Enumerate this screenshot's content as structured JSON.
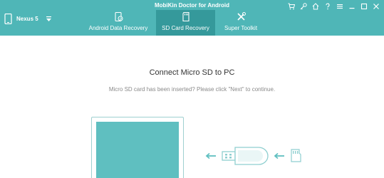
{
  "app": {
    "title": "MobiKin Doctor for Android"
  },
  "device": {
    "name": "Nexus 5"
  },
  "tabs": [
    {
      "label": "Android Data Recovery",
      "icon": "refresh-phone-icon"
    },
    {
      "label": "SD Card Recovery",
      "icon": "sd-card-icon",
      "active": true
    },
    {
      "label": "Super Toolkit",
      "icon": "tools-icon"
    }
  ],
  "window_controls": [
    "cart-icon",
    "key-icon",
    "home-icon",
    "help-icon",
    "menu-icon",
    "minimize-icon",
    "maximize-icon",
    "close-icon"
  ],
  "main": {
    "heading": "Connect Micro SD to PC",
    "subtext": "Micro SD card has been inserted? Please click \"Next\" to continue."
  },
  "colors": {
    "accent": "#4fb6b7",
    "active_tab": "#35999b",
    "screen": "#5fbfc0"
  }
}
